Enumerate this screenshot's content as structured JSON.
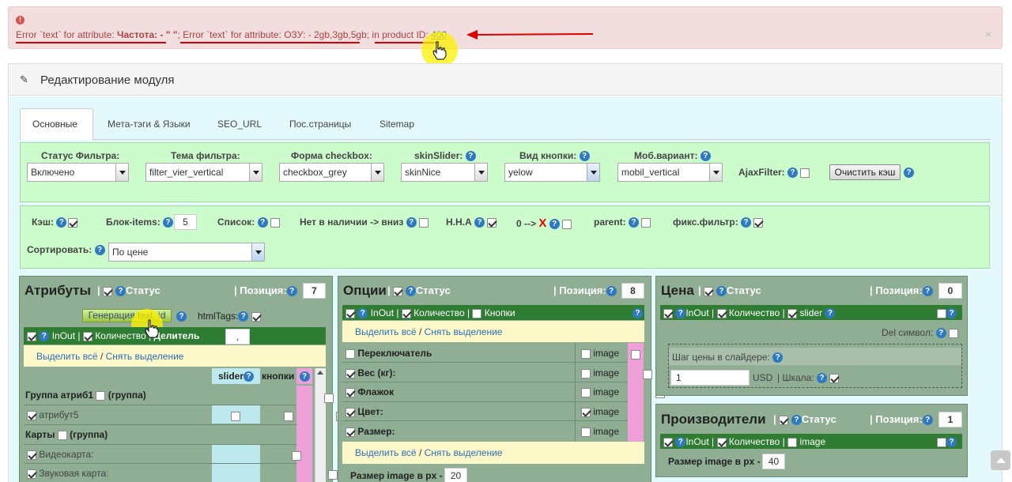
{
  "alert": {
    "icon": "exclamation-icon",
    "prefix": "Error `text` for attribute: ",
    "attr1": "Частота: - \" \"",
    "sep": "; Error `text` for attribute: ",
    "attr2": "ОЗУ: - 2gb,3gb,5gb",
    "mid": "; in ",
    "pid_label": "product ID:",
    "pid": "400",
    "close": "×"
  },
  "module": {
    "title": "Редактирование модуля"
  },
  "tabs": [
    {
      "label": "Основные"
    },
    {
      "label": "Мета-тэги & Языки"
    },
    {
      "label": "SEO_URL"
    },
    {
      "label": "Пос.страницы"
    },
    {
      "label": "Sitemap"
    }
  ],
  "filters": {
    "status": {
      "label": "Статус Фильтра:",
      "value": "Включено"
    },
    "theme": {
      "label": "Тема фильтра:",
      "value": "filter_vier_vertical"
    },
    "checkbox": {
      "label": "Форма checkbox:",
      "value": "checkbox_grey"
    },
    "skin": {
      "label": "skinSlider:",
      "value": "skinNice"
    },
    "button": {
      "label": "Вид кнопки:",
      "value": "yelow"
    },
    "mobile": {
      "label": "Моб.вариант:",
      "value": "mobil_vertical"
    },
    "ajax": {
      "label": "AjaxFilter:"
    },
    "clear": {
      "label": "Очистить кэш"
    }
  },
  "options": {
    "cache": "Кэш:",
    "block_items": "Блок-items:",
    "block_value": "5",
    "list": "Список:",
    "out_of_stock": "Нет в наличии -> вниз",
    "nna": "Н.Н.А",
    "zero": "0 -->",
    "x": "X",
    "parent": "parent:",
    "fixed": "фикс.фильтр:",
    "sort": "Сортировать:",
    "sort_value": "По цене"
  },
  "attributes": {
    "title": "Атрибуты",
    "status": "Статус",
    "position_label": "Позиция:",
    "position": "7",
    "gen": "Генерация text_id",
    "html_tags": "htmlTags:",
    "inout": "InOut",
    "quantity": "Количество",
    "divider": "Делитель",
    "divider_value": ",",
    "select_all": "Выделить всё",
    "deselect": "Снять выделение",
    "slash": "/",
    "col_slider": "slider",
    "col_buttons": "кнопки",
    "group1": "Группа атриб1",
    "group_tag": "(группа)",
    "attr5": "атрибут5",
    "cards": "Карты",
    "video": "Видеокарта:",
    "sound": "Звуковая карта:"
  },
  "opts": {
    "title": "Опции",
    "status": "Статус",
    "position_label": "Позиция:",
    "position": "8",
    "inout": "InOut",
    "quantity": "Количество",
    "buttons": "Кнопки",
    "select_all": "Выделить всё",
    "deselect": "Снять выделение",
    "slash": "/",
    "rows": [
      {
        "label": "Переключатель",
        "img": "image"
      },
      {
        "label": "Вес (кг):",
        "img": "image"
      },
      {
        "label": "Флажок",
        "img": "image"
      },
      {
        "label": "Цвет:",
        "img": "image"
      },
      {
        "label": "Размер:",
        "img": "image"
      }
    ],
    "img_size_label": "Размер image в px -",
    "img_size": "20"
  },
  "price": {
    "title": "Цена",
    "status": "Статус",
    "position_label": "Позиция:",
    "position": "0",
    "inout": "InOut",
    "quantity": "Количество",
    "slider": "slider",
    "del_symbol": "Del символ:",
    "step_label": "Шаг цены в слайдере:",
    "step_value": "1",
    "currency": "USD",
    "scale": "Шкала:"
  },
  "manuf": {
    "title": "Производители",
    "status": "Статус",
    "position_label": "Позиция:",
    "position": "1",
    "inout": "InOut",
    "quantity": "Количество",
    "image": "image",
    "img_size_label": "Размер image в px -",
    "img_size": "40"
  }
}
